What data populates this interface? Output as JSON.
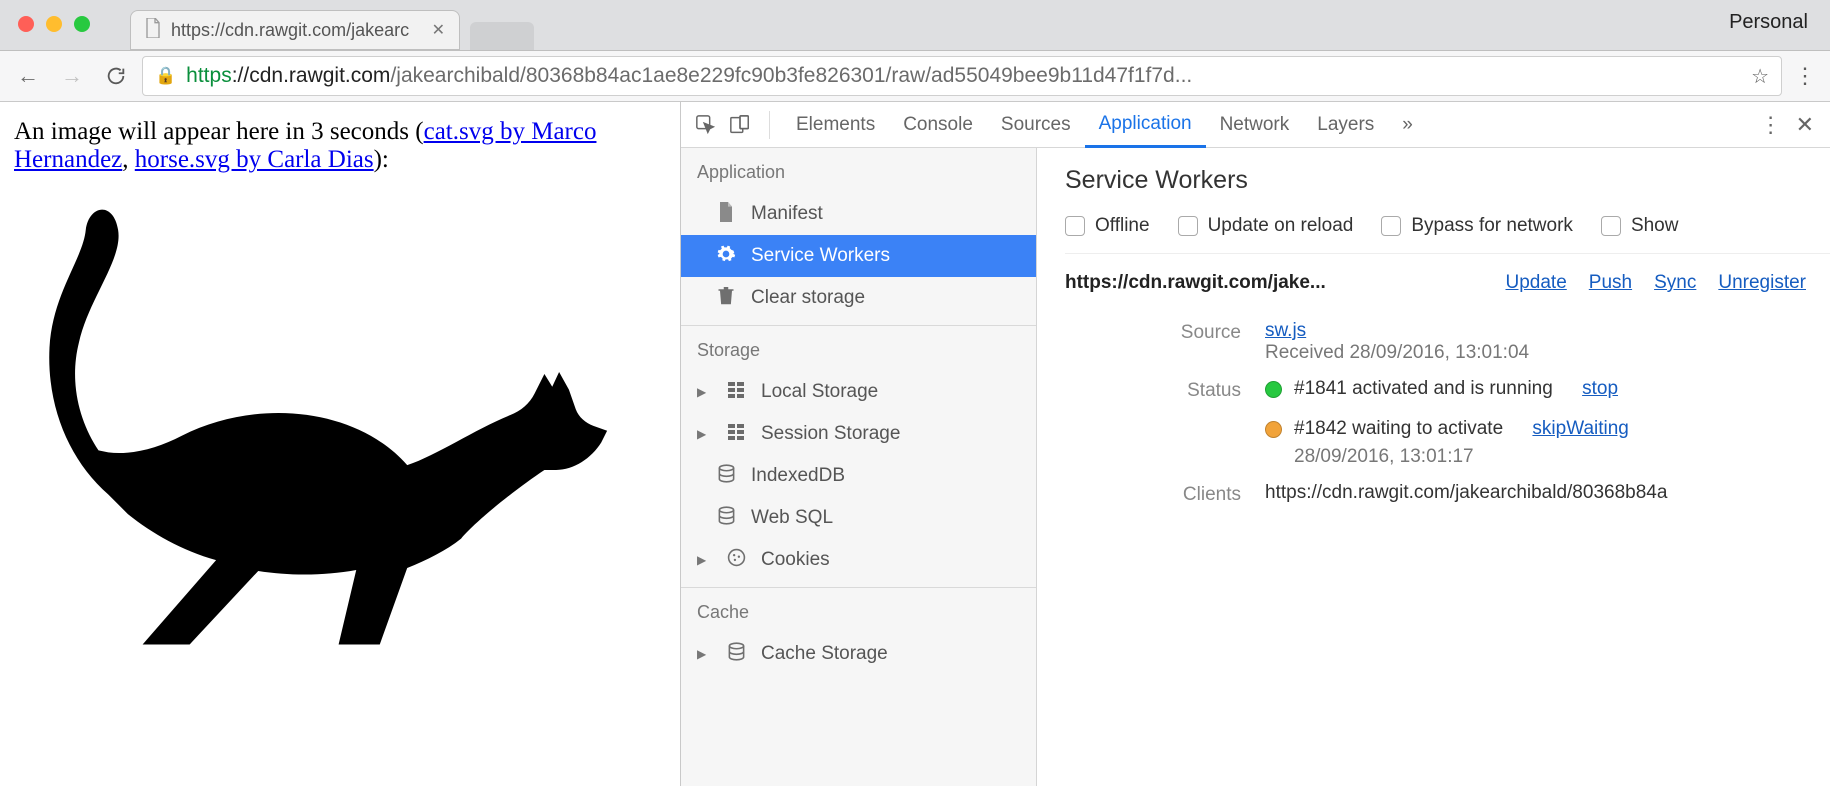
{
  "chrome": {
    "personal_label": "Personal",
    "tab_title": "https://cdn.rawgit.com/jakearc",
    "url_proto": "https",
    "url_host": "://cdn.rawgit.com",
    "url_path": "/jakearchibald/80368b84ac1ae8e229fc90b3fe826301/raw/ad55049bee9b11d47f1f7d..."
  },
  "page": {
    "text_prefix": "An image will appear here in 3 seconds (",
    "link1_text": "cat.svg by Marco Hernandez",
    "sep": ", ",
    "link2_text": "horse.svg by Carla Dias",
    "text_suffix": "):"
  },
  "devtools": {
    "tabs": [
      "Elements",
      "Console",
      "Sources",
      "Application",
      "Network",
      "Layers"
    ],
    "sidebar": {
      "group_app": "Application",
      "manifest": "Manifest",
      "service_workers": "Service Workers",
      "clear_storage": "Clear storage",
      "group_storage": "Storage",
      "local_storage": "Local Storage",
      "session_storage": "Session Storage",
      "indexeddb": "IndexedDB",
      "websql": "Web SQL",
      "cookies": "Cookies",
      "group_cache": "Cache",
      "cache_storage": "Cache Storage"
    },
    "panel": {
      "title": "Service Workers",
      "offline": "Offline",
      "update_on_reload": "Update on reload",
      "bypass": "Bypass for network",
      "show": "Show",
      "scope_url": "https://cdn.rawgit.com/jake...",
      "links": {
        "update": "Update",
        "push": "Push",
        "sync": "Sync",
        "unregister": "Unregister"
      },
      "source_label": "Source",
      "source_file": "sw.js",
      "source_received": "Received 28/09/2016, 13:01:04",
      "status_label": "Status",
      "status1_text": "#1841 activated and is running",
      "status1_action": "stop",
      "status2_text": "#1842 waiting to activate",
      "status2_action": "skipWaiting",
      "status2_time": "28/09/2016, 13:01:17",
      "clients_label": "Clients",
      "clients_url": "https://cdn.rawgit.com/jakearchibald/80368b84a"
    }
  }
}
